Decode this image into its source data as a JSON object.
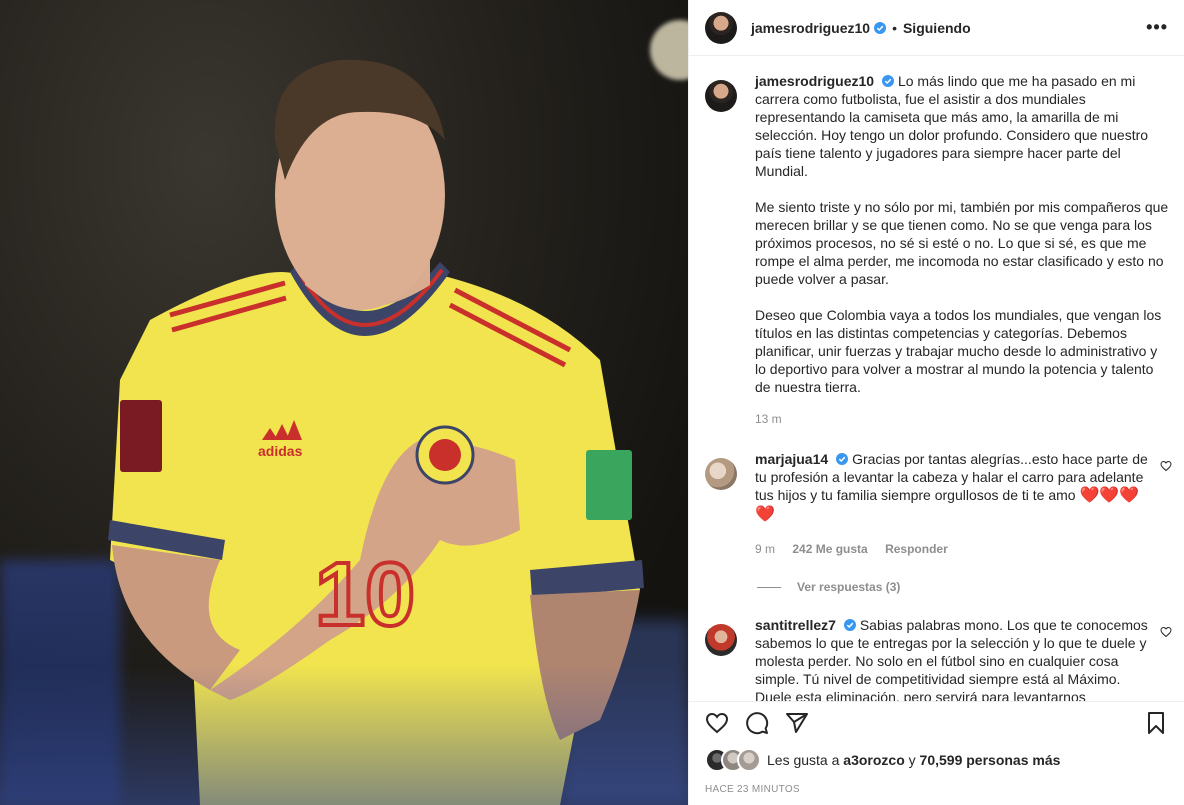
{
  "post": {
    "image_alt": "Jugador con camiseta amarilla de Colombia con la mano en el pecho",
    "author": {
      "username": "jamesrodriguez10",
      "verified": true,
      "follow_status": "Siguiendo",
      "separator": "•"
    },
    "more_icon": "more-horizontal-icon",
    "caption": {
      "paragraphs": [
        "Lo más lindo que me ha pasado en mi carrera como futbolista, fue el asistir a dos mundiales representando la camiseta que más amo, la amarilla de mi selección. Hoy tengo un dolor profundo. Considero que nuestro país tiene talento y jugadores para siempre hacer parte del Mundial.",
        "Me siento triste y no sólo por mi, también por mis compañeros que merecen brillar y se que tienen como. No se que venga para los próximos procesos, no sé si esté o no. Lo que si sé, es que me rompe el alma perder, me incomoda no estar clasificado y esto no puede volver a pasar.",
        "Deseo que Colombia vaya a todos los mundiales, que vengan los títulos en las distintas competencias y categorías. Debemos planificar, unir fuerzas y trabajar mucho desde lo administrativo y lo deportivo para volver a mostrar al mundo la potencia y talento de nuestra tierra."
      ],
      "time": "13 m"
    },
    "comments": [
      {
        "username": "marjajua14",
        "verified": true,
        "text": "Gracias por tantas alegrías...esto hace parte de tu profesión a levantar la cabeza y halar el carro para adelante tus hijos y tu familia siempre orgullosos de ti te amo",
        "emoji": "❤️❤️❤️ ❤️",
        "time": "9 m",
        "likes": "242 Me gusta",
        "reply": "Responder",
        "view_replies": "Ver respuestas (3)"
      },
      {
        "username": "santitrellez7",
        "verified": true,
        "text": "Sabias palabras mono. Los que te conocemos sabemos lo que te entregas por la selección y lo que te duele y molesta perder. No solo en el fútbol sino en cualquier cosa simple. Tú nivel de competitividad siempre está al Máximo. Duele esta eliminación, pero servirá para levantarnos"
      }
    ],
    "actions": {
      "like": "heart-icon",
      "comment": "comment-icon",
      "share": "send-icon",
      "save": "bookmark-icon"
    },
    "likes_summary": {
      "prefix": "Les gusta a",
      "user": "a3orozco",
      "middle": "y",
      "count": "70,599 personas más"
    },
    "timestamp": "HACE 23 MINUTOS"
  }
}
